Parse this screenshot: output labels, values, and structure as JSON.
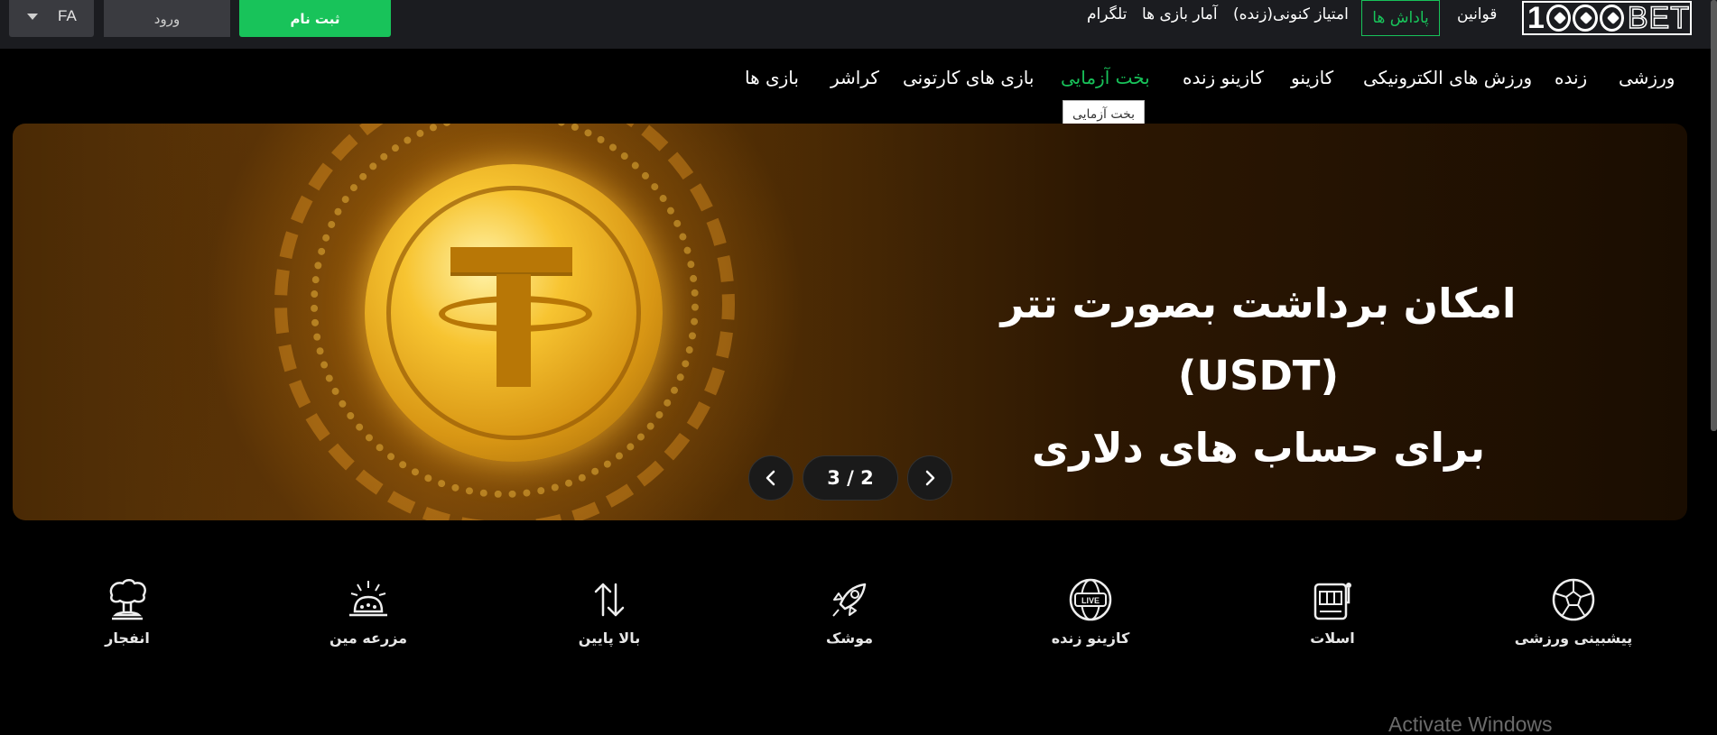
{
  "header": {
    "language": "FA",
    "login_label": "ورود",
    "signup_label": "ثبت نام",
    "links": [
      "قوانین",
      "پاداش ها",
      "امتیاز کنونی(زنده)",
      "آمار بازی ها",
      "تلگرام"
    ],
    "logo_text": "1000BET"
  },
  "nav": {
    "items": [
      "ورزشی",
      "زنده",
      "ورزش های الکترونیکی",
      "کازینو",
      "کازینو زنده",
      "بخت آزمایی",
      "بازی های کارتونی",
      "کراشر",
      "بازی ها"
    ],
    "active_index": 5,
    "tooltip": "بخت آزمایی"
  },
  "banner": {
    "line1": "امکان برداشت بصورت تتر (USDT)",
    "line2": "برای حساب های دلاری",
    "pager": "3 / 2"
  },
  "categories": [
    {
      "label": "پیشبینی ورزشی",
      "icon": "soccer-ball-icon"
    },
    {
      "label": "اسلات",
      "icon": "slot-machine-icon"
    },
    {
      "label": "کازینو زنده",
      "icon": "live-globe-icon"
    },
    {
      "label": "موشک",
      "icon": "rocket-icon"
    },
    {
      "label": "بالا پایین",
      "icon": "up-down-arrows-icon"
    },
    {
      "label": "مزرعه مین",
      "icon": "mine-icon"
    },
    {
      "label": "انفجار",
      "icon": "explosion-icon"
    }
  ],
  "watermark": "Activate Windows",
  "colors": {
    "accent": "#18c35a",
    "topbar": "#1b1c20",
    "button_dark": "#3a3b40"
  }
}
